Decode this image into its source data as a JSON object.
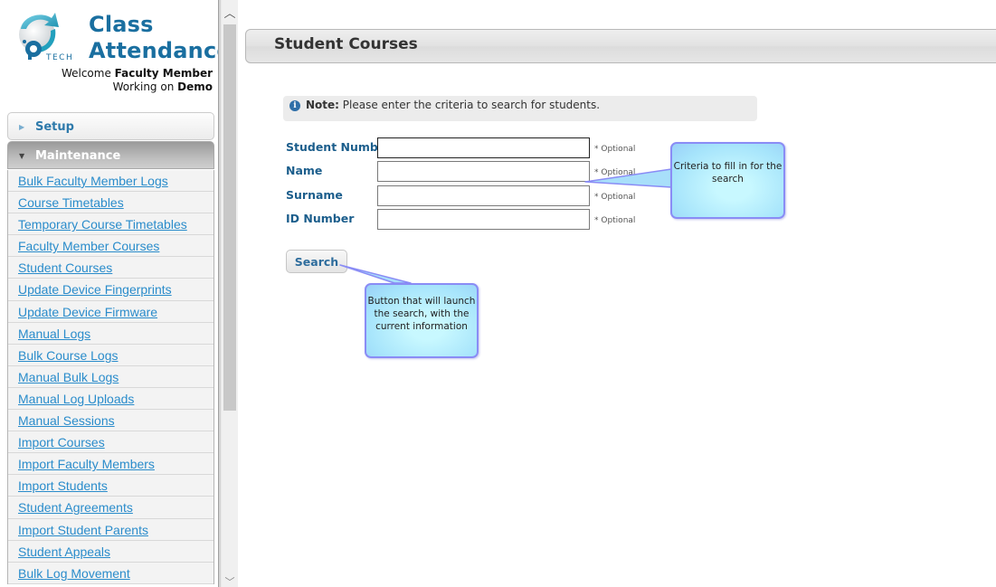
{
  "app": {
    "title_line1": "Class",
    "title_line2": "Attendance",
    "logo_text": "TECH",
    "welcome_prefix": "Welcome ",
    "user_name": "Faculty Member",
    "working_prefix": "Working on ",
    "workspace": "Demo"
  },
  "sidebar": {
    "setup_label": "Setup",
    "maintenance_label": "Maintenance",
    "items": [
      {
        "label": "Bulk Faculty Member Logs"
      },
      {
        "label": "Course Timetables"
      },
      {
        "label": "Temporary Course Timetables"
      },
      {
        "label": "Faculty Member Courses"
      },
      {
        "label": "Student Courses"
      },
      {
        "label": "Update Device Fingerprints"
      },
      {
        "label": "Update Device Firmware"
      },
      {
        "label": "Manual Logs"
      },
      {
        "label": "Bulk Course Logs"
      },
      {
        "label": "Manual Bulk Logs"
      },
      {
        "label": "Manual Log Uploads"
      },
      {
        "label": "Manual Sessions"
      },
      {
        "label": "Import Courses"
      },
      {
        "label": "Import Faculty Members"
      },
      {
        "label": "Import Students"
      },
      {
        "label": "Student Agreements"
      },
      {
        "label": "Import Student Parents"
      },
      {
        "label": "Student Appeals"
      },
      {
        "label": "Bulk Log Movement"
      }
    ]
  },
  "main": {
    "page_title": "Student Courses",
    "note_label": "Note:",
    "note_text": " Please enter the criteria to search for students.",
    "fields": [
      {
        "label": "Student Number",
        "value": "",
        "hint": "* Optional"
      },
      {
        "label": "Name",
        "value": "",
        "hint": "* Optional"
      },
      {
        "label": "Surname",
        "value": "",
        "hint": "* Optional"
      },
      {
        "label": "ID Number",
        "value": "",
        "hint": "* Optional"
      }
    ],
    "search_label": "Search"
  },
  "callouts": {
    "criteria": "Criteria to fill in for the search",
    "button": "Button that will launch the search, with the current information"
  },
  "colors": {
    "brand": "#1a6fa0",
    "link": "#2a8ccb",
    "callout_border": "#8a8cf5",
    "callout_fill": "#b5eefd"
  }
}
